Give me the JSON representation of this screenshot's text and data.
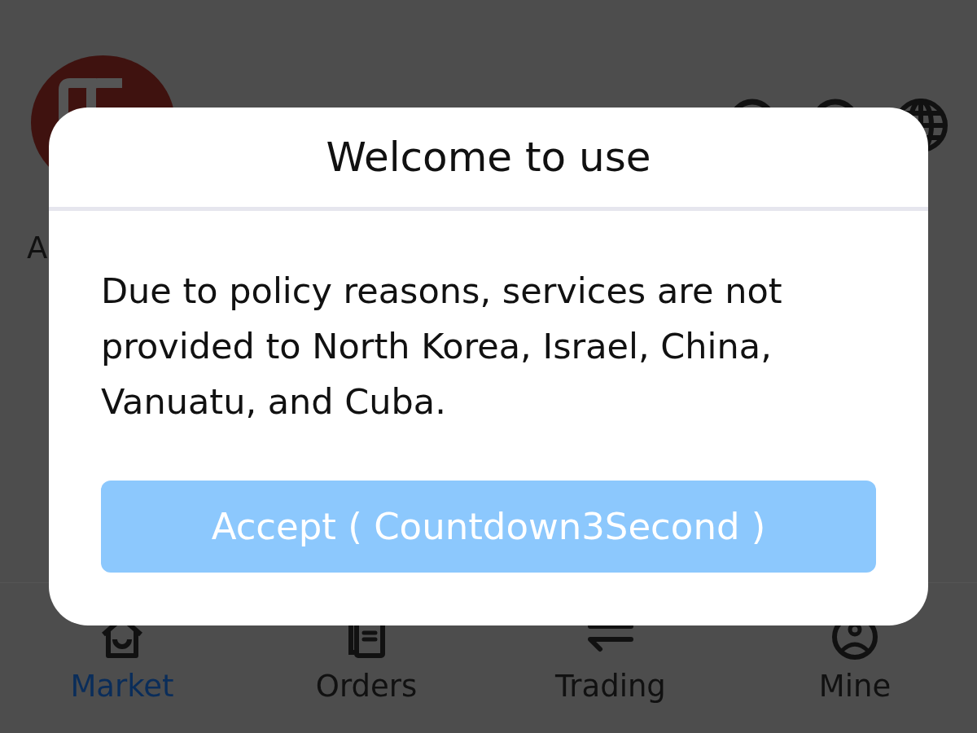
{
  "page": {
    "section_title": "A"
  },
  "dialog": {
    "title": "Welcome to use",
    "message": "Due to policy reasons, services are not provided to North Korea, Israel, China, Vanuatu, and Cuba.",
    "button": {
      "label": "Accept ( Countdown3Second )",
      "disabled": true
    }
  },
  "bottom_nav": [
    {
      "label": "Market",
      "selected": true
    },
    {
      "label": "Orders",
      "selected": false
    },
    {
      "label": "Trading",
      "selected": false
    },
    {
      "label": "Mine",
      "selected": false
    }
  ]
}
